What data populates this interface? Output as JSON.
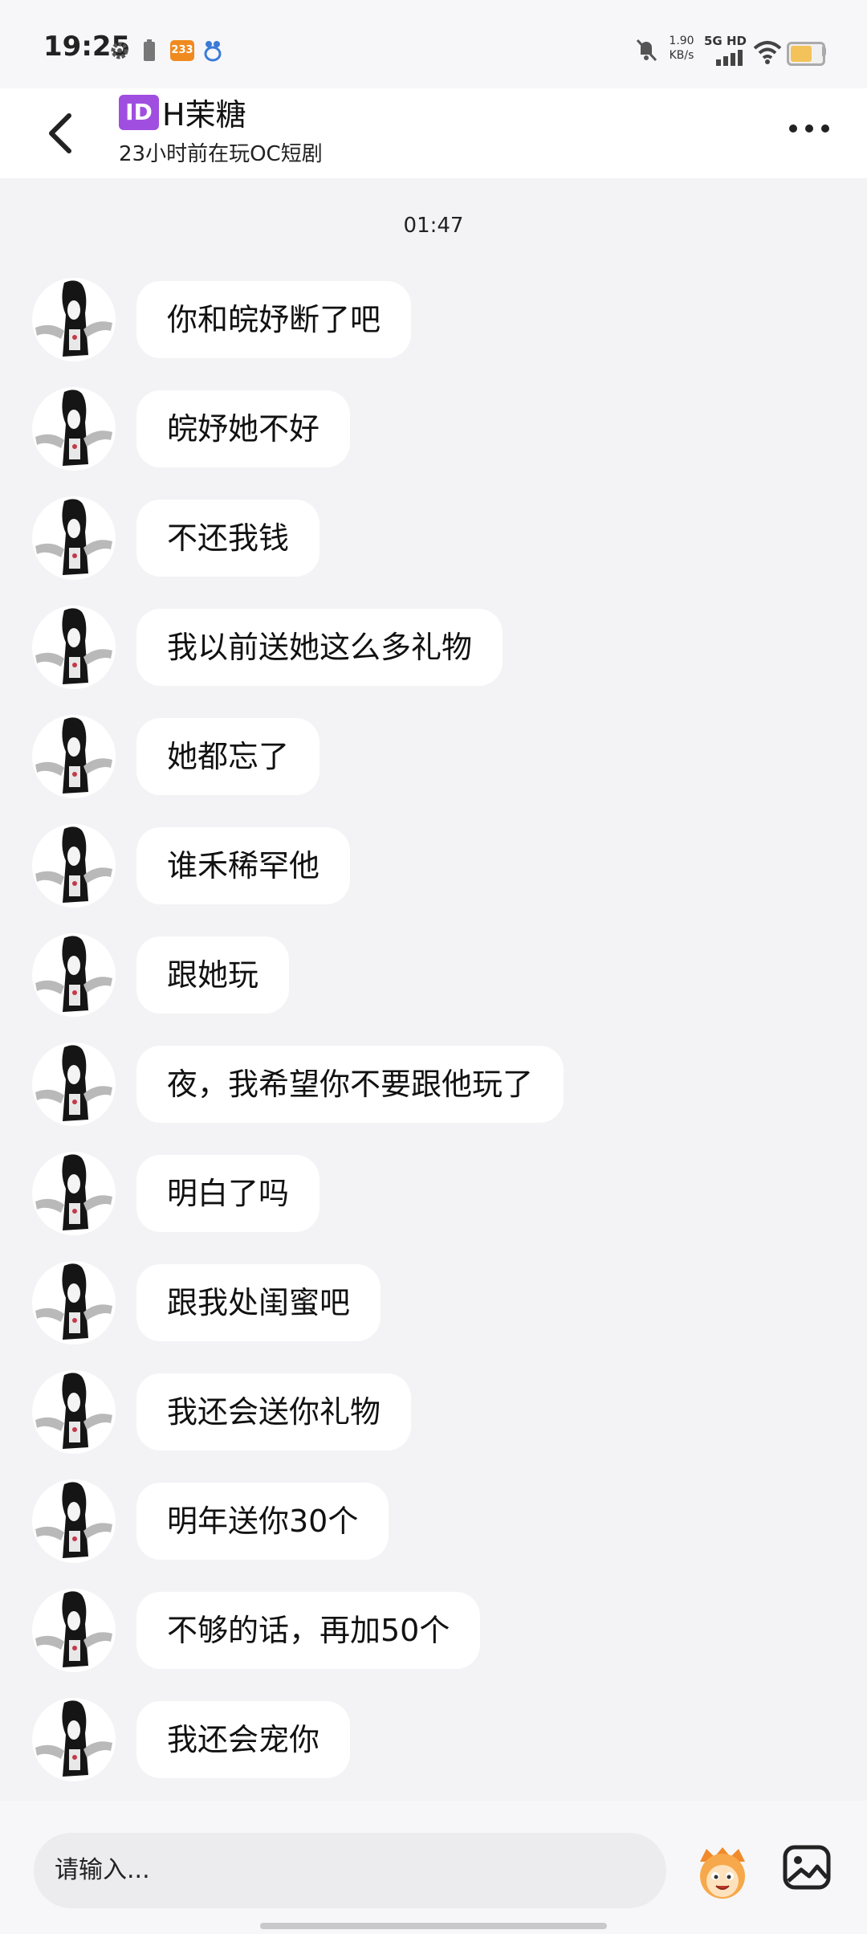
{
  "status_bar": {
    "time": "19:25",
    "app_badge": "233",
    "net_speed_value": "1.90",
    "net_speed_unit": "KB/s",
    "network": "5G HD",
    "icons": [
      "gear-icon",
      "battery-small-icon",
      "app-233-icon",
      "paw-icon",
      "mute-icon",
      "signal-icon",
      "wifi-icon",
      "battery-icon"
    ]
  },
  "header": {
    "id_badge": "ID",
    "title": "H茉糖",
    "subtitle": "23小时前在玩OC短剧"
  },
  "chat": {
    "timestamp": "01:47",
    "messages": [
      {
        "text": "你和皖妤断了吧"
      },
      {
        "text": "皖妤她不好"
      },
      {
        "text": "不还我钱"
      },
      {
        "text": "我以前送她这么多礼物"
      },
      {
        "text": "她都忘了"
      },
      {
        "text": "谁禾稀罕他"
      },
      {
        "text": "跟她玩"
      },
      {
        "text": "夜，我希望你不要跟他玩了"
      },
      {
        "text": "明白了吗"
      },
      {
        "text": "跟我处闺蜜吧"
      },
      {
        "text": "我还会送你礼物"
      },
      {
        "text": "明年送你30个"
      },
      {
        "text": "不够的话，再加50个"
      },
      {
        "text": "我还会宠你"
      }
    ]
  },
  "input": {
    "placeholder": "请输入..."
  },
  "colors": {
    "background": "#f3f3f6",
    "bubble": "#ffffff",
    "badge": "#a04ee0",
    "battery": "#f3c25a"
  }
}
